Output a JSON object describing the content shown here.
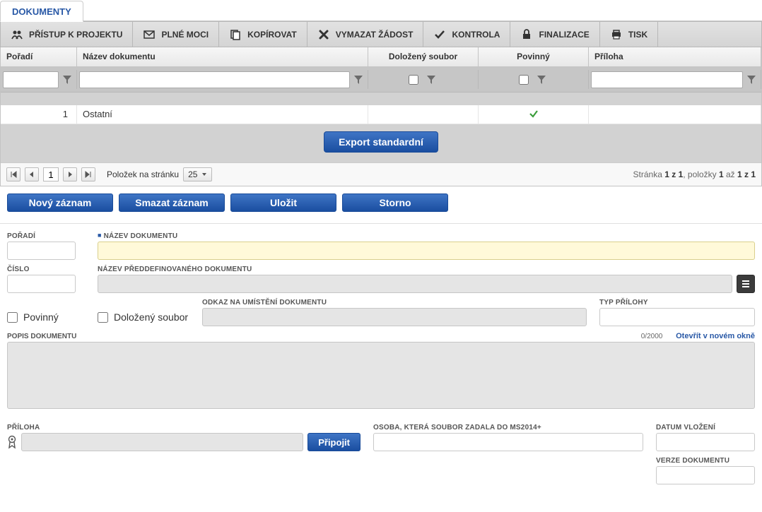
{
  "tab": {
    "label": "DOKUMENTY"
  },
  "toolbar": [
    {
      "id": "pristup",
      "label": "PŘÍSTUP K PROJEKTU",
      "icon": "people-icon"
    },
    {
      "id": "plnemoci",
      "label": "PLNÉ MOCI",
      "icon": "envelope-icon"
    },
    {
      "id": "kopirovat",
      "label": "KOPÍROVAT",
      "icon": "copy-icon"
    },
    {
      "id": "vymazat",
      "label": "VYMAZAT ŽÁDOST",
      "icon": "delete-x-icon"
    },
    {
      "id": "kontrola",
      "label": "KONTROLA",
      "icon": "check-icon"
    },
    {
      "id": "finalizace",
      "label": "FINALIZACE",
      "icon": "lock-icon"
    },
    {
      "id": "tisk",
      "label": "TISK",
      "icon": "print-icon"
    }
  ],
  "grid": {
    "columns": {
      "poradi": "Pořadí",
      "nazev": "Název dokumentu",
      "dolozeny": "Doložený soubor",
      "povinny": "Povinný",
      "priloha": "Příloha"
    },
    "rows": [
      {
        "poradi": "1",
        "nazev": "Ostatní",
        "dolozeny": false,
        "povinny": true,
        "priloha": ""
      }
    ]
  },
  "export_button": "Export standardní",
  "pager": {
    "page": "1",
    "per_page_label": "Položek na stránku",
    "per_page_value": "25",
    "info_prefix": "Stránka ",
    "info_page_total": "1 z 1",
    "info_mid": ", položky ",
    "info_items_from": "1",
    "info_items_to": " až ",
    "info_items_total": "1 z 1"
  },
  "actions": {
    "new": "Nový záznam",
    "delete": "Smazat záznam",
    "save": "Uložit",
    "cancel": "Storno"
  },
  "form": {
    "poradi_label": "POŘADÍ",
    "cislo_label": "ČÍSLO",
    "nazev_dok_label": "NÁZEV DOKUMENTU",
    "nazev_preddef_label": "NÁZEV PŘEDDEFINOVANÉHO DOKUMENTU",
    "povinny_label": "Povinný",
    "dolozeny_label": "Doložený soubor",
    "odkaz_label": "ODKAZ NA UMÍSTĚNÍ DOKUMENTU",
    "typ_prilohy_label": "TYP PŘÍLOHY",
    "popis_label": "POPIS DOKUMENTU",
    "popis_counter": "0/2000",
    "popis_link": "Otevřít v novém okně",
    "priloha_label": "PŘÍLOHA",
    "pripojit": "Připojit",
    "osoba_label": "OSOBA, KTERÁ SOUBOR ZADALA DO MS2014+",
    "datum_vlozeni_label": "DATUM VLOŽENÍ",
    "verze_label": "VERZE DOKUMENTU"
  }
}
